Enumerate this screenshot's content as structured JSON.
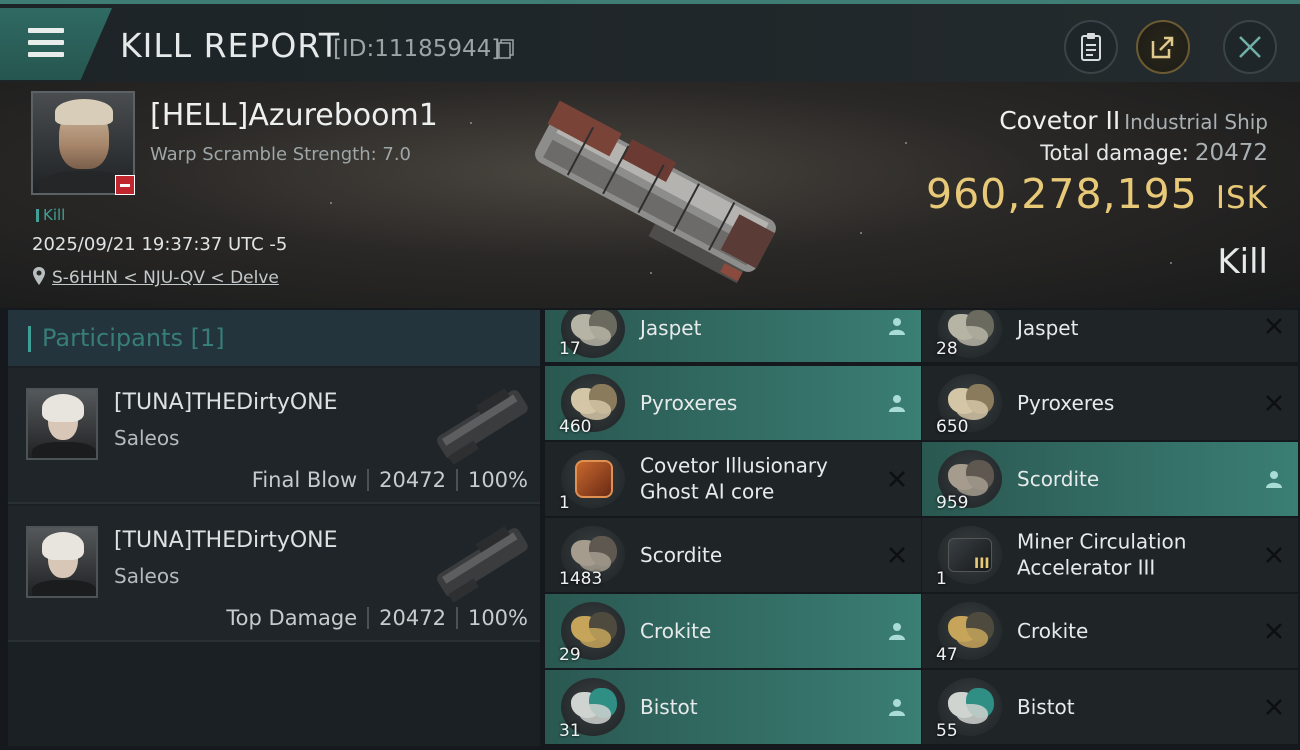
{
  "header": {
    "title": "KILL REPORT",
    "report_id": "[ID:11185944]"
  },
  "victim": {
    "name": "[HELL]Azureboom1",
    "warp_scramble": "Warp Scramble Strength: 7.0",
    "tag": "Kill",
    "datetime": "2025/09/21 19:37:37 UTC -5",
    "location": "S-6HHN < NJU-QV < Delve"
  },
  "ship": {
    "name": "Covetor II",
    "class": "Industrial Ship",
    "total_damage_label": "Total damage:",
    "total_damage": "20472",
    "isk_value": "960,278,195",
    "isk_unit": "ISK",
    "result": "Kill"
  },
  "participants": {
    "label": "Participants [1]",
    "rows": [
      {
        "name": "[TUNA]THEDirtyONE",
        "ship": "Saleos",
        "role": "Final Blow",
        "damage": "20472",
        "percent": "100%"
      },
      {
        "name": "[TUNA]THEDirtyONE",
        "ship": "Saleos",
        "role": "Top Damage",
        "damage": "20472",
        "percent": "100%"
      }
    ]
  },
  "items": {
    "col1": [
      {
        "qty": "17",
        "name": "Jaspet",
        "status": "dropped",
        "icon": "jaspet-ore-icon"
      },
      {
        "qty": "460",
        "name": "Pyroxeres",
        "status": "dropped",
        "icon": "pyroxeres-ore-icon"
      },
      {
        "qty": "1",
        "name": "Covetor Illusionary",
        "name2": "Ghost AI core",
        "status": "destroyed",
        "icon": "ai-core-icon"
      },
      {
        "qty": "1483",
        "name": "Scordite",
        "status": "destroyed",
        "icon": "scordite-ore-icon"
      },
      {
        "qty": "29",
        "name": "Crokite",
        "status": "dropped",
        "icon": "crokite-ore-icon"
      },
      {
        "qty": "31",
        "name": "Bistot",
        "status": "dropped",
        "icon": "bistot-ore-icon"
      }
    ],
    "col2": [
      {
        "qty": "28",
        "name": "Jaspet",
        "status": "destroyed",
        "icon": "jaspet-ore-icon"
      },
      {
        "qty": "650",
        "name": "Pyroxeres",
        "status": "destroyed",
        "icon": "pyroxeres-ore-icon"
      },
      {
        "qty": "959",
        "name": "Scordite",
        "status": "dropped",
        "icon": "scordite-ore-icon"
      },
      {
        "qty": "1",
        "name": "Miner Circulation",
        "name2": "Accelerator III",
        "status": "destroyed",
        "icon": "module-icon",
        "tier": "III"
      },
      {
        "qty": "47",
        "name": "Crokite",
        "status": "destroyed",
        "icon": "crokite-ore-icon"
      },
      {
        "qty": "55",
        "name": "Bistot",
        "status": "destroyed",
        "icon": "bistot-ore-icon"
      }
    ]
  },
  "colors": {
    "accent_teal": "#3fa095",
    "dropped_bg": "#3a7e74",
    "destroyed_bg": "#1f2427",
    "isk_gold": "#e8c977"
  }
}
